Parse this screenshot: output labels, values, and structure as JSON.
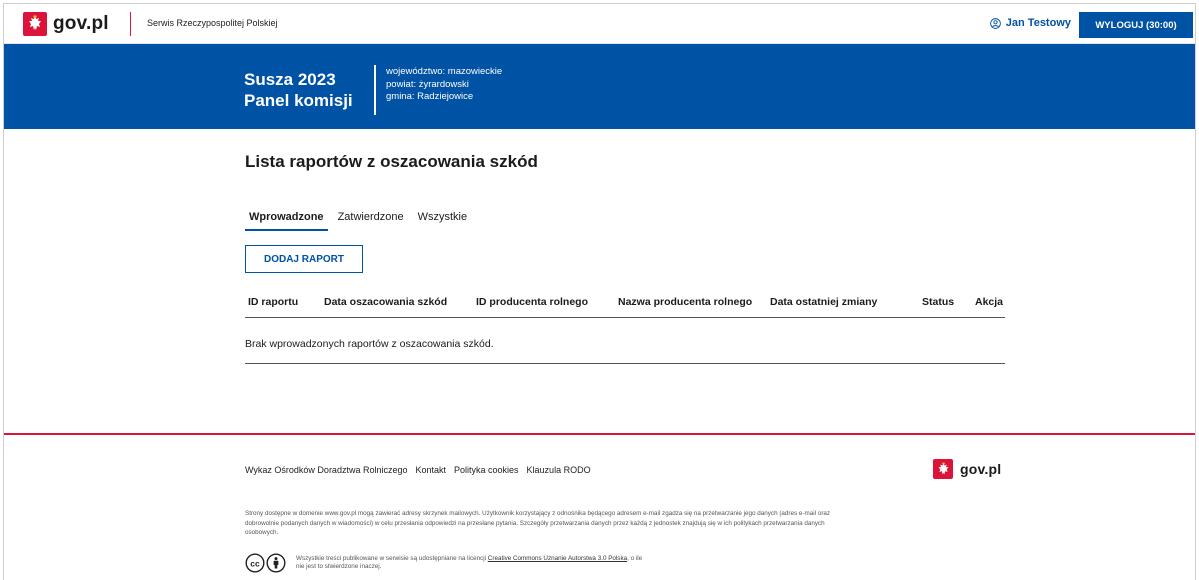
{
  "header": {
    "logo_text": "gov.pl",
    "service_name": "Serwis Rzeczypospolitej Polskiej",
    "user_name": "Jan Testowy",
    "logout_label": "WYLOGUJ (30:00)"
  },
  "banner": {
    "title_line1": "Susza 2023",
    "title_line2": "Panel komisji",
    "info": [
      "województwo: mazowieckie",
      "powiat: żyrardowski",
      "gmina: Radziejowice"
    ]
  },
  "main": {
    "heading": "Lista raportów z oszacowania szkód",
    "tabs": [
      {
        "label": "Wprowadzone",
        "active": true
      },
      {
        "label": "Zatwierdzone",
        "active": false
      },
      {
        "label": "Wszystkie",
        "active": false
      }
    ],
    "add_button": "DODAJ RAPORT",
    "table": {
      "columns": [
        "ID raportu",
        "Data oszacowania szkód",
        "ID producenta rolnego",
        "Nazwa producenta rolnego",
        "Data ostatniej zmiany",
        "Status",
        "Akcja"
      ],
      "empty_message": "Brak wprowadzonych raportów z oszacowania szkód."
    }
  },
  "footer": {
    "links": [
      "Wykaz Ośrodków Doradztwa Rolniczego",
      "Kontakt",
      "Polityka cookies",
      "Klauzula RODO"
    ],
    "logo_text": "gov.pl",
    "note_line1": "Strony dostępne w domenie www.gov.pl mogą zawierać adresy skrzynek mailowych. Użytkownik korzystający z odnośnika będącego adresem e-mail zgadza się na przetwarzanie jego danych (adres e-mail oraz",
    "note_line2": "dobrowolnie podanych danych w wiadomości) w celu przesłania odpowiedzi na przesłane pytania. Szczegóły przetwarzania danych przez każdą z jednostek znajdują się w ich politykach przetwarzania danych",
    "note_line3": "osobowych.",
    "license_before": "Wszystkie treści publikowane w serwisie są udostępniane na licencji ",
    "license_link": "Creative Commons Uznanie Autorstwa 3.0 Polska",
    "license_after": ", o ile",
    "license_line2": "nie jest to stwierdzone inaczej."
  },
  "colors": {
    "brand_blue": "#0052a5",
    "brand_red": "#dc143c"
  }
}
